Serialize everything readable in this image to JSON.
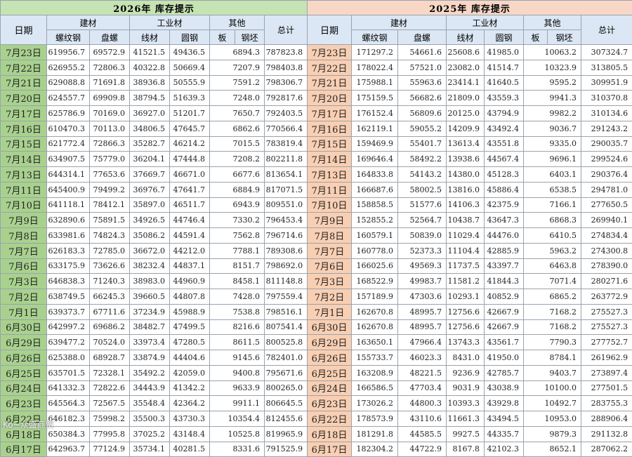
{
  "left": {
    "title": "2026年  库存提示",
    "headers": {
      "date": "日期",
      "construction": "建材",
      "industrial": "工业材",
      "other": "其他",
      "total": "总计",
      "rebar": "螺纹钢",
      "coil": "盘螺",
      "wire": "线材",
      "round": "圆钢",
      "plate": "板",
      "billet": "钢坯"
    },
    "rows": [
      [
        "7月23日",
        "619956.7",
        "69572.9",
        "41521.5",
        "49436.5",
        "6894.3",
        "787823.8"
      ],
      [
        "7月22日",
        "626955.2",
        "72806.3",
        "40322.8",
        "50669.4",
        "7207.9",
        "798403.8"
      ],
      [
        "7月21日",
        "629088.8",
        "71691.8",
        "38936.8",
        "50555.9",
        "7591.2",
        "798306.7"
      ],
      [
        "7月20日",
        "624557.7",
        "69909.8",
        "38794.5",
        "51639.3",
        "7248.0",
        "792817.6"
      ],
      [
        "7月17日",
        "625786.9",
        "70169.0",
        "36927.0",
        "51201.7",
        "7650.7",
        "792403.5"
      ],
      [
        "7月16日",
        "610470.3",
        "70113.0",
        "34806.5",
        "47645.7",
        "6862.6",
        "770566.4"
      ],
      [
        "7月15日",
        "621772.4",
        "72866.3",
        "35282.7",
        "46214.2",
        "7015.5",
        "783819.4"
      ],
      [
        "7月14日",
        "634907.5",
        "75779.0",
        "36204.1",
        "47444.8",
        "7208.2",
        "802211.8"
      ],
      [
        "7月13日",
        "644314.1",
        "77653.6",
        "37669.7",
        "46671.0",
        "6677.6",
        "813654.1"
      ],
      [
        "7月11日",
        "645400.9",
        "79499.2",
        "36976.7",
        "47641.7",
        "6884.9",
        "817071.5"
      ],
      [
        "7月10日",
        "641118.1",
        "78412.1",
        "35897.0",
        "46511.7",
        "6943.9",
        "809551.0"
      ],
      [
        "7月9日",
        "632890.6",
        "75891.5",
        "34926.5",
        "44746.4",
        "7330.2",
        "796453.4"
      ],
      [
        "7月8日",
        "633981.6",
        "74824.3",
        "35086.2",
        "44591.4",
        "7562.8",
        "796714.6"
      ],
      [
        "7月7日",
        "626183.3",
        "72785.0",
        "36672.0",
        "44212.0",
        "7788.1",
        "789308.6"
      ],
      [
        "7月6日",
        "633175.9",
        "73626.6",
        "38232.4",
        "44837.1",
        "8151.7",
        "798692.0"
      ],
      [
        "7月3日",
        "646838.3",
        "71240.3",
        "38983.0",
        "44960.9",
        "8458.1",
        "811148.8"
      ],
      [
        "7月2日",
        "638749.5",
        "66245.3",
        "39660.5",
        "44807.8",
        "7428.0",
        "797559.4"
      ],
      [
        "7月1日",
        "639373.7",
        "67711.6",
        "37234.9",
        "45988.9",
        "7538.8",
        "798516.1"
      ],
      [
        "6月30日",
        "642997.2",
        "69686.2",
        "38482.7",
        "47499.5",
        "8216.6",
        "807541.4"
      ],
      [
        "6月29日",
        "639477.2",
        "70524.0",
        "33973.4",
        "47280.5",
        "8611.5",
        "800525.8"
      ],
      [
        "6月26日",
        "625388.0",
        "68928.7",
        "33874.9",
        "44404.6",
        "9145.6",
        "782401.0"
      ],
      [
        "6月25日",
        "635701.5",
        "72328.1",
        "35492.2",
        "42059.0",
        "9400.8",
        "795671.6"
      ],
      [
        "6月24日",
        "641332.3",
        "72822.6",
        "34443.9",
        "41342.2",
        "9633.9",
        "800265.0"
      ],
      [
        "6月23日",
        "645564.3",
        "72567.5",
        "35548.4",
        "42364.2",
        "9911.1",
        "806645.5"
      ],
      [
        "6月22日",
        "646182.3",
        "75998.2",
        "35500.3",
        "43730.3",
        "10354.4",
        "812455.6"
      ],
      [
        "6月18日",
        "650384.3",
        "77995.8",
        "37025.2",
        "43148.4",
        "10525.8",
        "819965.9"
      ],
      [
        "6月17日",
        "642963.7",
        "77124.9",
        "35734.1",
        "40281.5",
        "8331.6",
        "791525.9"
      ]
    ]
  },
  "right": {
    "title": "2025年  库存提示",
    "headers": {
      "date": "日期",
      "construction": "建材",
      "industrial": "工业材",
      "other": "其他",
      "total": "总计",
      "rebar": "螺纹钢",
      "coil": "盘螺",
      "wire": "线材",
      "round": "圆钢",
      "plate": "板",
      "billet": "钢坯"
    },
    "rows": [
      [
        "7月23日",
        "171297.2",
        "54661.6",
        "25608.6",
        "41985.0",
        "10063.2",
        "307324.7"
      ],
      [
        "7月22日",
        "178022.4",
        "57521.0",
        "23082.0",
        "41514.7",
        "10323.9",
        "313805.5"
      ],
      [
        "7月21日",
        "175988.1",
        "55963.6",
        "23414.1",
        "41640.5",
        "9595.2",
        "309951.9"
      ],
      [
        "7月20日",
        "175159.5",
        "56682.6",
        "21809.0",
        "43559.3",
        "9941.3",
        "310370.8"
      ],
      [
        "7月17日",
        "176152.4",
        "56809.6",
        "20125.0",
        "43794.9",
        "9982.2",
        "310134.6"
      ],
      [
        "7月16日",
        "162119.1",
        "59055.2",
        "14209.9",
        "43492.4",
        "9036.7",
        "291243.2"
      ],
      [
        "7月15日",
        "159469.9",
        "55401.7",
        "13613.4",
        "43551.8",
        "9335.0",
        "290035.7"
      ],
      [
        "7月14日",
        "169646.4",
        "58492.2",
        "13938.6",
        "44567.4",
        "9696.1",
        "299524.6"
      ],
      [
        "7月13日",
        "164833.8",
        "54143.2",
        "14380.0",
        "45128.3",
        "6403.1",
        "290376.4"
      ],
      [
        "7月11日",
        "166687.6",
        "58002.5",
        "13816.0",
        "45886.4",
        "6538.5",
        "294781.0"
      ],
      [
        "7月10日",
        "158858.5",
        "51577.6",
        "14106.3",
        "42375.9",
        "7166.1",
        "277650.5"
      ],
      [
        "7月9日",
        "152855.2",
        "52564.7",
        "10438.7",
        "43647.3",
        "6868.3",
        "269940.1"
      ],
      [
        "7月8日",
        "160579.1",
        "50839.0",
        "11029.4",
        "44476.0",
        "6410.5",
        "274834.4"
      ],
      [
        "7月7日",
        "160778.0",
        "52373.3",
        "11104.4",
        "42885.9",
        "5963.2",
        "274300.8"
      ],
      [
        "7月6日",
        "166025.6",
        "49569.3",
        "11737.5",
        "43397.7",
        "6463.8",
        "278390.0"
      ],
      [
        "7月3日",
        "168522.9",
        "49983.7",
        "11581.2",
        "41844.3",
        "7071.4",
        "280271.6"
      ],
      [
        "7月2日",
        "157189.9",
        "47303.6",
        "10293.1",
        "40852.9",
        "6865.2",
        "263772.9"
      ],
      [
        "7月1日",
        "162670.8",
        "48995.7",
        "12756.6",
        "42667.9",
        "7168.2",
        "275527.3"
      ],
      [
        "6月30日",
        "162670.8",
        "48995.7",
        "12756.6",
        "42667.9",
        "7168.2",
        "275527.3"
      ],
      [
        "6月29日",
        "163650.1",
        "47966.4",
        "13743.3",
        "43561.7",
        "7790.3",
        "277752.7"
      ],
      [
        "6月26日",
        "155733.7",
        "46023.3",
        "8431.0",
        "41950.0",
        "8784.1",
        "261962.9"
      ],
      [
        "6月25日",
        "163208.9",
        "48221.5",
        "9236.9",
        "42785.7",
        "9403.7",
        "273897.4"
      ],
      [
        "6月24日",
        "166586.5",
        "47703.4",
        "9031.9",
        "43038.9",
        "10100.0",
        "277501.5"
      ],
      [
        "6月23日",
        "173026.2",
        "44800.3",
        "10393.3",
        "43929.8",
        "10492.7",
        "283755.3"
      ],
      [
        "6月22日",
        "178573.9",
        "43110.6",
        "11661.3",
        "43494.5",
        "10953.0",
        "288906.4"
      ],
      [
        "6月18日",
        "181291.8",
        "44585.5",
        "9927.5",
        "44335.7",
        "9879.3",
        "291132.8"
      ],
      [
        "6月17日",
        "182304.2",
        "44722.9",
        "8167.8",
        "42102.3",
        "8652.1",
        "287062.2"
      ]
    ]
  },
  "watermark": "Ko~众盛商贸"
}
